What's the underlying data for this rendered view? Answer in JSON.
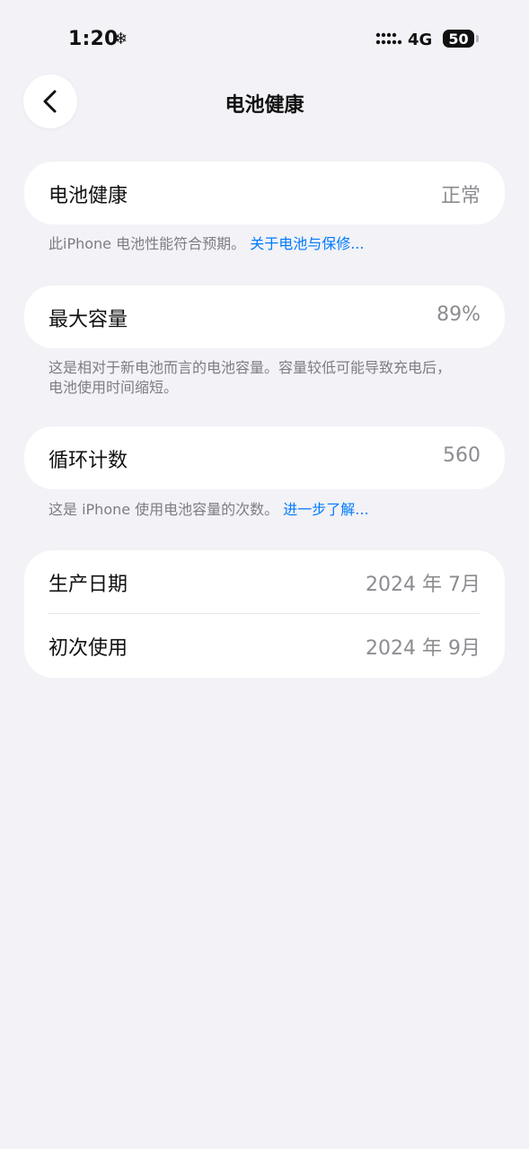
{
  "status_bar": {
    "time": "1:20",
    "snow_icon": "❄",
    "network": "4G",
    "battery_level": "50"
  },
  "navigation": {
    "title": "电池健康",
    "back_icon": "chevron-left-icon"
  },
  "sections": {
    "battery_health": {
      "label": "电池健康",
      "value": "正常",
      "note": "此iPhone 电池性能符合预期。",
      "link": "关于电池与保修..."
    },
    "maximum_capacity": {
      "label": "最大容量",
      "value": "89%",
      "note_line1": "这是相对于新电池而言的电池容量。容量较低可能导致充电后，",
      "note_line2": "电池使用时间缩短。"
    },
    "cycle_count": {
      "label": "循环计数",
      "value": "560",
      "note": "这是 iPhone 使用电池容量的次数。",
      "link": "进一步了解..."
    },
    "dates": {
      "manufacture_label": "生产日期",
      "manufacture_value": "2024 年 7月",
      "first_use_label": "初次使用",
      "first_use_value": "2024 年 9月"
    }
  },
  "colors": {
    "background": "#f2f2f7",
    "card": "#ffffff",
    "link": "#007aff",
    "secondary_text": "#8c8c91"
  }
}
